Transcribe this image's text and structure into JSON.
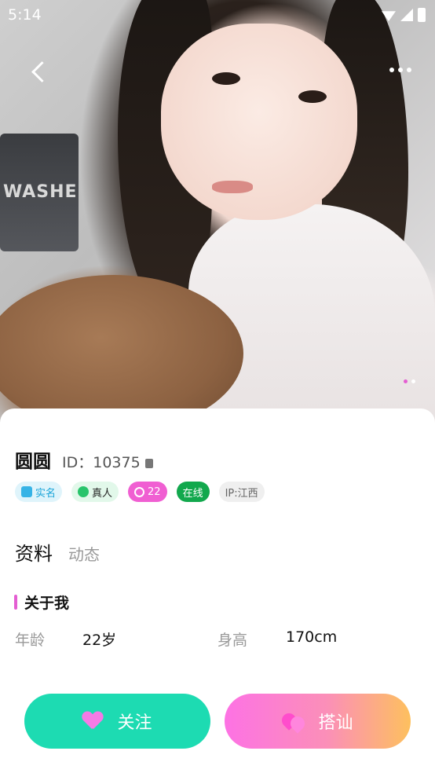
{
  "status_bar": {
    "time": "5:14",
    "icons": [
      "wifi-icon",
      "signal-icon",
      "battery-charging-icon"
    ]
  },
  "photo": {
    "page_indicator": {
      "count": 2,
      "active_index": 0,
      "active_color": "#e45ed2",
      "inactive_color": "#ffffff"
    }
  },
  "profile": {
    "name": "圆圆",
    "id_text": "ID：10375",
    "tags": {
      "realname": "实名",
      "real_person": "真人",
      "level": "22",
      "online": "在线",
      "ip": "IP:江西"
    }
  },
  "tabs": {
    "active": "资料",
    "inactive": "动态"
  },
  "about": {
    "title": "关于我",
    "age_label": "年龄",
    "age_value": "22岁",
    "height_label": "身高",
    "height_value": "170cm"
  },
  "actions": {
    "follow": "关注",
    "chat": "搭讪"
  },
  "colors": {
    "accent_pink": "#e45ed2",
    "follow_green": "#1ddbb2",
    "online_green": "#12a84d"
  }
}
